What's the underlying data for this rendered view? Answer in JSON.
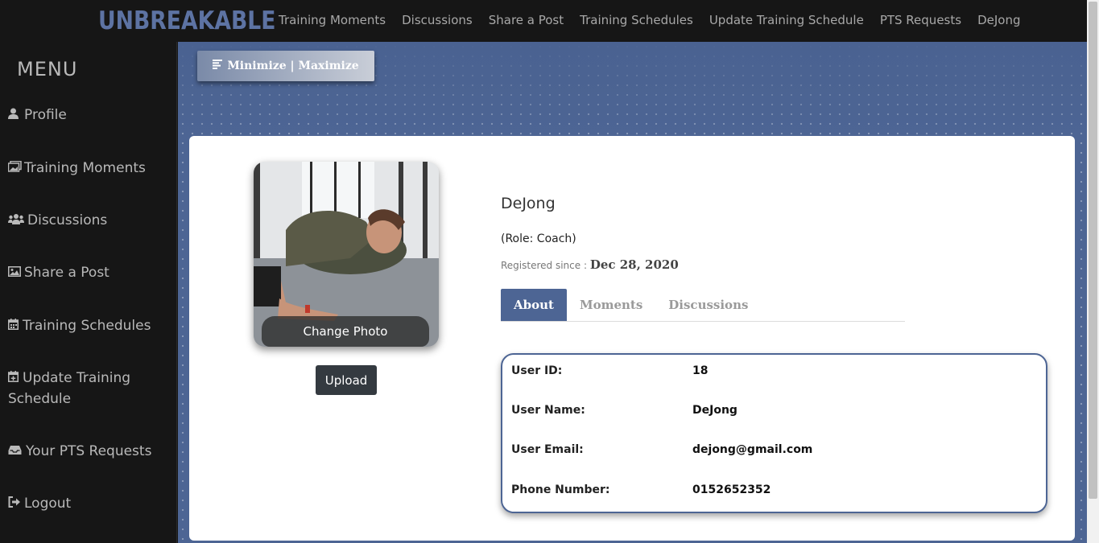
{
  "brand": {
    "logo_text": "UNBREAKABLE"
  },
  "topnav": {
    "items": [
      {
        "label": "Training Moments"
      },
      {
        "label": "Discussions"
      },
      {
        "label": "Share a Post"
      },
      {
        "label": "Training Schedules"
      },
      {
        "label": "Update Training Schedule"
      },
      {
        "label": "PTS Requests"
      },
      {
        "label": "DeJong"
      }
    ]
  },
  "sidebar": {
    "title": "MENU",
    "items": [
      {
        "label": "Profile",
        "icon": "user-icon"
      },
      {
        "label": "Training Moments",
        "icon": "images-icon"
      },
      {
        "label": "Discussions",
        "icon": "users-icon"
      },
      {
        "label": "Share a Post",
        "icon": "image-icon"
      },
      {
        "label": "Training Schedules",
        "icon": "calendar-icon"
      },
      {
        "label": "Update Training Schedule",
        "icon": "calendar-plus-icon"
      },
      {
        "label": "Your PTS Requests",
        "icon": "inbox-icon"
      },
      {
        "label": "Logout",
        "icon": "sign-out-icon"
      }
    ]
  },
  "toolbar": {
    "minmax_label": "Minimize | Maximize"
  },
  "profile": {
    "change_photo_label": "Change Photo",
    "upload_label": "Upload",
    "name": "DeJong",
    "role": "(Role: Coach)",
    "registered_prefix": "Registered since :",
    "registered_date": "Dec 28, 2020",
    "tabs": [
      {
        "label": "About"
      },
      {
        "label": "Moments"
      },
      {
        "label": "Discussions"
      }
    ],
    "details": [
      {
        "label": "User ID:",
        "value": "18"
      },
      {
        "label": "User Name:",
        "value": "DeJong"
      },
      {
        "label": "User Email:",
        "value": "dejong@gmail.com"
      },
      {
        "label": "Phone Number:",
        "value": "0152652352"
      }
    ]
  },
  "colors": {
    "accent": "#4d6594",
    "sidebar_bg": "#161616",
    "nav_text": "#a8a8a8"
  }
}
